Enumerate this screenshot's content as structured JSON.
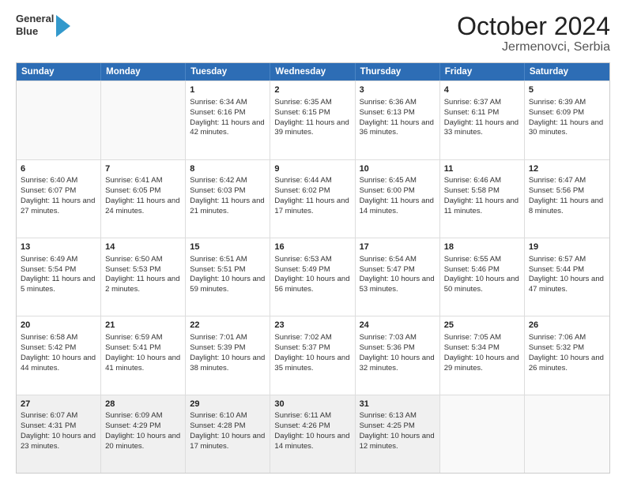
{
  "header": {
    "logo_line1": "General",
    "logo_line2": "Blue",
    "title": "October 2024",
    "subtitle": "Jermenovci, Serbia"
  },
  "weekdays": [
    "Sunday",
    "Monday",
    "Tuesday",
    "Wednesday",
    "Thursday",
    "Friday",
    "Saturday"
  ],
  "rows": [
    [
      {
        "day": "",
        "sunrise": "",
        "sunset": "",
        "daylight": "",
        "empty": true
      },
      {
        "day": "",
        "sunrise": "",
        "sunset": "",
        "daylight": "",
        "empty": true
      },
      {
        "day": "1",
        "sunrise": "Sunrise: 6:34 AM",
        "sunset": "Sunset: 6:16 PM",
        "daylight": "Daylight: 11 hours and 42 minutes.",
        "empty": false
      },
      {
        "day": "2",
        "sunrise": "Sunrise: 6:35 AM",
        "sunset": "Sunset: 6:15 PM",
        "daylight": "Daylight: 11 hours and 39 minutes.",
        "empty": false
      },
      {
        "day": "3",
        "sunrise": "Sunrise: 6:36 AM",
        "sunset": "Sunset: 6:13 PM",
        "daylight": "Daylight: 11 hours and 36 minutes.",
        "empty": false
      },
      {
        "day": "4",
        "sunrise": "Sunrise: 6:37 AM",
        "sunset": "Sunset: 6:11 PM",
        "daylight": "Daylight: 11 hours and 33 minutes.",
        "empty": false
      },
      {
        "day": "5",
        "sunrise": "Sunrise: 6:39 AM",
        "sunset": "Sunset: 6:09 PM",
        "daylight": "Daylight: 11 hours and 30 minutes.",
        "empty": false
      }
    ],
    [
      {
        "day": "6",
        "sunrise": "Sunrise: 6:40 AM",
        "sunset": "Sunset: 6:07 PM",
        "daylight": "Daylight: 11 hours and 27 minutes.",
        "empty": false
      },
      {
        "day": "7",
        "sunrise": "Sunrise: 6:41 AM",
        "sunset": "Sunset: 6:05 PM",
        "daylight": "Daylight: 11 hours and 24 minutes.",
        "empty": false
      },
      {
        "day": "8",
        "sunrise": "Sunrise: 6:42 AM",
        "sunset": "Sunset: 6:03 PM",
        "daylight": "Daylight: 11 hours and 21 minutes.",
        "empty": false
      },
      {
        "day": "9",
        "sunrise": "Sunrise: 6:44 AM",
        "sunset": "Sunset: 6:02 PM",
        "daylight": "Daylight: 11 hours and 17 minutes.",
        "empty": false
      },
      {
        "day": "10",
        "sunrise": "Sunrise: 6:45 AM",
        "sunset": "Sunset: 6:00 PM",
        "daylight": "Daylight: 11 hours and 14 minutes.",
        "empty": false
      },
      {
        "day": "11",
        "sunrise": "Sunrise: 6:46 AM",
        "sunset": "Sunset: 5:58 PM",
        "daylight": "Daylight: 11 hours and 11 minutes.",
        "empty": false
      },
      {
        "day": "12",
        "sunrise": "Sunrise: 6:47 AM",
        "sunset": "Sunset: 5:56 PM",
        "daylight": "Daylight: 11 hours and 8 minutes.",
        "empty": false
      }
    ],
    [
      {
        "day": "13",
        "sunrise": "Sunrise: 6:49 AM",
        "sunset": "Sunset: 5:54 PM",
        "daylight": "Daylight: 11 hours and 5 minutes.",
        "empty": false
      },
      {
        "day": "14",
        "sunrise": "Sunrise: 6:50 AM",
        "sunset": "Sunset: 5:53 PM",
        "daylight": "Daylight: 11 hours and 2 minutes.",
        "empty": false
      },
      {
        "day": "15",
        "sunrise": "Sunrise: 6:51 AM",
        "sunset": "Sunset: 5:51 PM",
        "daylight": "Daylight: 10 hours and 59 minutes.",
        "empty": false
      },
      {
        "day": "16",
        "sunrise": "Sunrise: 6:53 AM",
        "sunset": "Sunset: 5:49 PM",
        "daylight": "Daylight: 10 hours and 56 minutes.",
        "empty": false
      },
      {
        "day": "17",
        "sunrise": "Sunrise: 6:54 AM",
        "sunset": "Sunset: 5:47 PM",
        "daylight": "Daylight: 10 hours and 53 minutes.",
        "empty": false
      },
      {
        "day": "18",
        "sunrise": "Sunrise: 6:55 AM",
        "sunset": "Sunset: 5:46 PM",
        "daylight": "Daylight: 10 hours and 50 minutes.",
        "empty": false
      },
      {
        "day": "19",
        "sunrise": "Sunrise: 6:57 AM",
        "sunset": "Sunset: 5:44 PM",
        "daylight": "Daylight: 10 hours and 47 minutes.",
        "empty": false
      }
    ],
    [
      {
        "day": "20",
        "sunrise": "Sunrise: 6:58 AM",
        "sunset": "Sunset: 5:42 PM",
        "daylight": "Daylight: 10 hours and 44 minutes.",
        "empty": false
      },
      {
        "day": "21",
        "sunrise": "Sunrise: 6:59 AM",
        "sunset": "Sunset: 5:41 PM",
        "daylight": "Daylight: 10 hours and 41 minutes.",
        "empty": false
      },
      {
        "day": "22",
        "sunrise": "Sunrise: 7:01 AM",
        "sunset": "Sunset: 5:39 PM",
        "daylight": "Daylight: 10 hours and 38 minutes.",
        "empty": false
      },
      {
        "day": "23",
        "sunrise": "Sunrise: 7:02 AM",
        "sunset": "Sunset: 5:37 PM",
        "daylight": "Daylight: 10 hours and 35 minutes.",
        "empty": false
      },
      {
        "day": "24",
        "sunrise": "Sunrise: 7:03 AM",
        "sunset": "Sunset: 5:36 PM",
        "daylight": "Daylight: 10 hours and 32 minutes.",
        "empty": false
      },
      {
        "day": "25",
        "sunrise": "Sunrise: 7:05 AM",
        "sunset": "Sunset: 5:34 PM",
        "daylight": "Daylight: 10 hours and 29 minutes.",
        "empty": false
      },
      {
        "day": "26",
        "sunrise": "Sunrise: 7:06 AM",
        "sunset": "Sunset: 5:32 PM",
        "daylight": "Daylight: 10 hours and 26 minutes.",
        "empty": false
      }
    ],
    [
      {
        "day": "27",
        "sunrise": "Sunrise: 6:07 AM",
        "sunset": "Sunset: 4:31 PM",
        "daylight": "Daylight: 10 hours and 23 minutes.",
        "empty": false
      },
      {
        "day": "28",
        "sunrise": "Sunrise: 6:09 AM",
        "sunset": "Sunset: 4:29 PM",
        "daylight": "Daylight: 10 hours and 20 minutes.",
        "empty": false
      },
      {
        "day": "29",
        "sunrise": "Sunrise: 6:10 AM",
        "sunset": "Sunset: 4:28 PM",
        "daylight": "Daylight: 10 hours and 17 minutes.",
        "empty": false
      },
      {
        "day": "30",
        "sunrise": "Sunrise: 6:11 AM",
        "sunset": "Sunset: 4:26 PM",
        "daylight": "Daylight: 10 hours and 14 minutes.",
        "empty": false
      },
      {
        "day": "31",
        "sunrise": "Sunrise: 6:13 AM",
        "sunset": "Sunset: 4:25 PM",
        "daylight": "Daylight: 10 hours and 12 minutes.",
        "empty": false
      },
      {
        "day": "",
        "sunrise": "",
        "sunset": "",
        "daylight": "",
        "empty": true
      },
      {
        "day": "",
        "sunrise": "",
        "sunset": "",
        "daylight": "",
        "empty": true
      }
    ]
  ]
}
